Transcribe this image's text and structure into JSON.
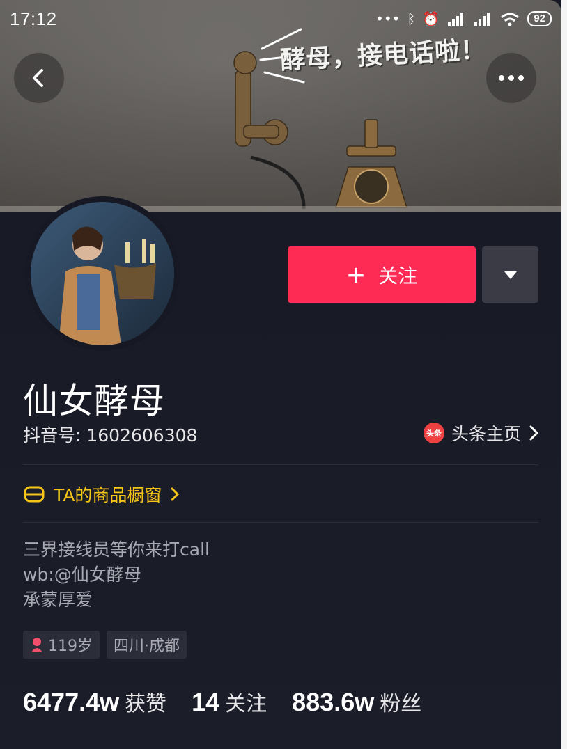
{
  "status_bar": {
    "time": "17:12",
    "battery": "92"
  },
  "cover": {
    "caption": "酵母，接电话啦！"
  },
  "profile": {
    "follow_label": "关注",
    "nickname": "仙女酵母",
    "douyin_id": "抖音号: 1602606308",
    "toutiao_badge": "头条",
    "toutiao_label": "头条主页",
    "shop_label": "TA的商品橱窗",
    "bio": [
      "三界接线员等你来打call",
      "wb:@仙女酵母",
      "承蒙厚爱"
    ],
    "tags": {
      "age": "119岁",
      "location": "四川·成都"
    },
    "stats": {
      "likes_num": "6477.4w",
      "likes_label": "获赞",
      "following_num": "14",
      "following_label": "关注",
      "fans_num": "883.6w",
      "fans_label": "粉丝"
    }
  },
  "colors": {
    "accent": "#fe2c55",
    "shop": "#f5c518",
    "background": "#161824"
  },
  "icons": [
    "back-arrow-icon",
    "more-icon",
    "plus-icon",
    "triangle-down-icon",
    "toutiao-icon",
    "chevron-right-icon",
    "shop-icon",
    "female-icon"
  ]
}
